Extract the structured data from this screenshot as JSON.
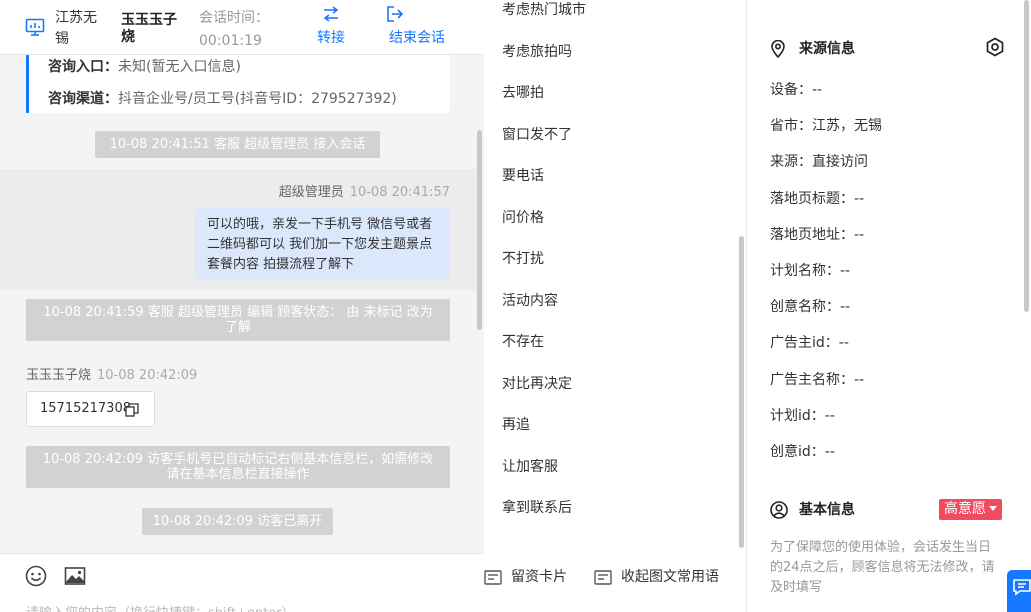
{
  "header": {
    "location": "江苏无锡",
    "visitor_name": "玉玉玉子烧",
    "session_label": "会话时间：",
    "session_time": "00:01:19",
    "transfer_label": "转接",
    "end_label": "结束会话"
  },
  "info_card": {
    "entry_label": "咨询入口：",
    "entry_value": "未知(暂无入口信息)",
    "channel_label": "咨询渠道：",
    "channel_value": "抖音企业号/员工号(抖音号ID：279527392)"
  },
  "messages": {
    "sys1": "10-08 20:41:51 客服 超级管理员 接入会话",
    "agent_name": "超级管理员",
    "agent_time": "10-08 20:41:57",
    "agent_text": "可以的哦，亲发一下手机号 微信号或者二维码都可以 我们加一下您发主题景点 套餐内容 拍摄流程了解下",
    "sys2": "10-08 20:41:59 客服 超级管理员 编辑 顾客状态： 由 未标记 改为 了解",
    "visitor_name": "玉玉玉子烧",
    "visitor_time": "10-08 20:42:09",
    "visitor_phone": "15715217308",
    "sys3": "10-08 20:42:09 访客手机号已自动标记右侧基本信息栏，如需修改请在基本信息栏直接操作",
    "sys4": "10-08 20:42:09 访客已离开"
  },
  "composer": {
    "placeholder": "请输入您的内容（换行快捷键：shift+enter）"
  },
  "quick_replies": [
    "考虑热门城市",
    "考虑旅拍吗",
    "去哪拍",
    "窗口发不了",
    "要电话",
    "问价格",
    "不打扰",
    "活动内容",
    "不存在",
    "对比再决定",
    "再追",
    "让加客服",
    "拿到联系后"
  ],
  "quick_tools": {
    "card": "留资卡片",
    "collapse": "收起图文常用语"
  },
  "source_info": {
    "title": "来源信息",
    "rows": [
      "设备：--",
      "省市：江苏，无锡",
      "来源：直接访问",
      "落地页标题：--",
      "落地页地址：--",
      "计划名称：--",
      "创意名称：--",
      "广告主id：--",
      "广告主名称：--",
      "计划id：--",
      "创意id：--"
    ]
  },
  "basic_info": {
    "title": "基本信息",
    "intent_badge": "高意愿",
    "note": "为了保障您的使用体验，会话发生当日的24点之后，顾客信息将无法修改，请及时填写"
  },
  "colors": {
    "accent": "#1677ff",
    "agent_bubble": "#dbe8fb",
    "system_msg": "#d2d2d2",
    "badge_red": "#f04b5e"
  }
}
